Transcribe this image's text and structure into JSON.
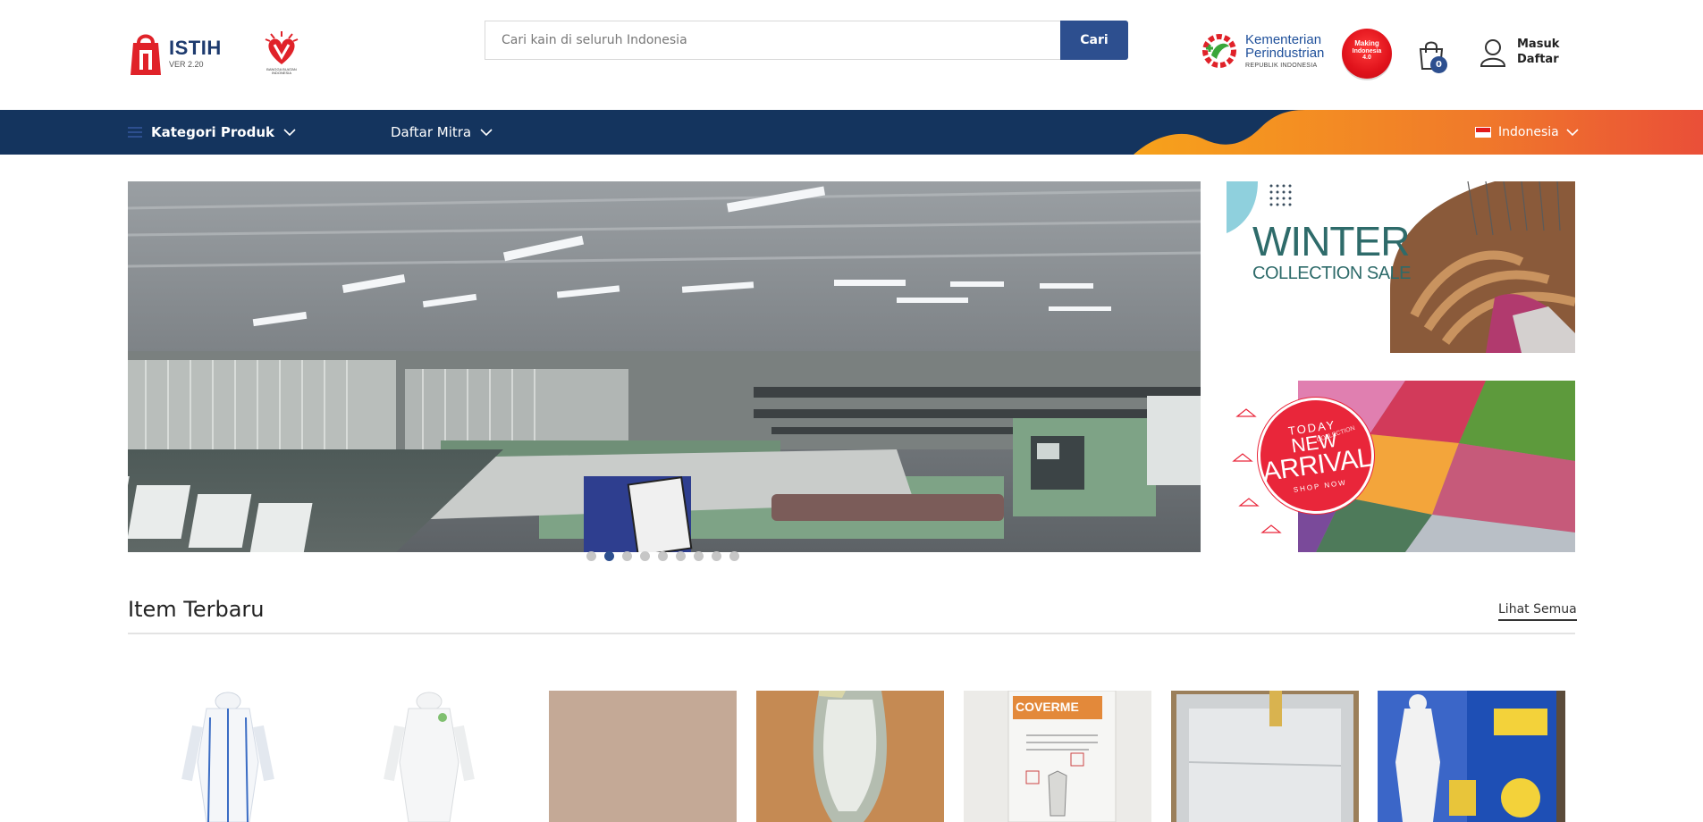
{
  "header": {
    "logo_name": "ISTIH",
    "logo_version": "VER 2.20",
    "bangga_caption": "BANGGA BUATAN INDONESIA",
    "search_placeholder": "Cari kain di seluruh Indonesia",
    "search_button": "Cari",
    "kemenperin": {
      "line1": "Kementerian",
      "line2": "Perindustrian",
      "line3": "REPUBLIK INDONESIA"
    },
    "making": {
      "line1": "Making",
      "line2": "Indonesia",
      "line3": "4.0"
    },
    "cart_count": "0",
    "login_label": "Masuk",
    "register_label": "Daftar"
  },
  "nav": {
    "category_label": "Kategori Produk",
    "partners_label": "Daftar Mitra",
    "language_label": "Indonesia"
  },
  "banners": {
    "winter_title": "WINTER",
    "winter_sub": "COLLECTION SALE",
    "arrival_today": "TODAY",
    "arrival_new": "NEW",
    "arrival_word": "ARRIVAL",
    "arrival_collection": "COLLECTION",
    "arrival_shop": "SHOP NOW",
    "arrival_tag": "NEW"
  },
  "slider": {
    "dots": 9,
    "active_index": 1
  },
  "latest": {
    "title": "Item Terbaru",
    "see_all": "Lihat Semua",
    "coverme_label": "COVERME"
  },
  "colors": {
    "primary": "#2d4f8f",
    "nav_bg": "#14345e",
    "accent_orange": "#f39a1f",
    "accent_red": "#e9263a"
  }
}
